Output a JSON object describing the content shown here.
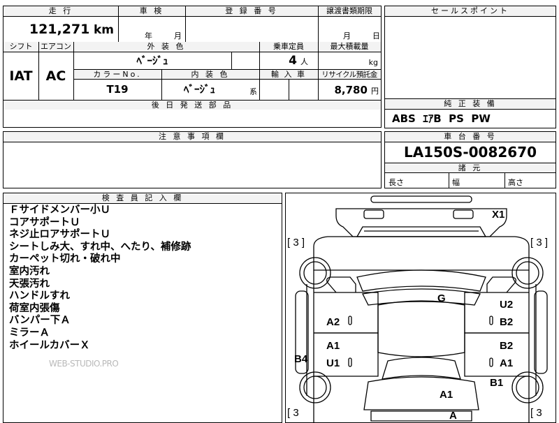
{
  "top": {
    "mileage_header": "走 行",
    "mileage_value": "121,271",
    "mileage_unit": "km",
    "inspection_header": "車 検",
    "inspection_year": "年",
    "inspection_month": "月",
    "registration_header": "登 録 番 号",
    "transfer_header": "譲渡書類期限",
    "transfer_month": "月",
    "transfer_day": "日",
    "shift_header": "シフト",
    "shift_value": "IAT",
    "ac_header": "エアコン",
    "ac_value": "AC",
    "exterior_color_header": "外 装 色",
    "exterior_color_value": "ﾍﾞｰｼﾞｭ",
    "capacity_header": "乗車定員",
    "capacity_value": "4",
    "capacity_unit": "人",
    "max_load_header": "最大積載量",
    "max_load_unit": "kg",
    "color_no_header": "カラーNo.",
    "color_no_value": "T19",
    "interior_color_header": "内 装 色",
    "interior_color_value": "ﾍﾞｰｼﾞｭ",
    "interior_color_suffix": "系",
    "import_header": "輸 入 車",
    "recycle_header": "リサイクル預託金",
    "recycle_value": "8,780",
    "recycle_unit": "円",
    "later_parts_header": "後 日 発 送 部 品"
  },
  "sales_point": {
    "header": "セールスポイント"
  },
  "equipment": {
    "header": "純 正 装 備",
    "value": "ABS  ｴｱB  PS  PW"
  },
  "notes": {
    "header": "注 意 事 項 欄"
  },
  "chassis": {
    "header": "車 台 番 号",
    "value": "LA150S-0082670",
    "dims_header": "諸 元",
    "length_label": "長さ",
    "width_label": "幅",
    "height_label": "高さ"
  },
  "inspector": {
    "header": "検 査 員 記 入 欄",
    "items": [
      "Ｆサイドメンバー小Ｕ",
      "コアサポートＵ",
      "ネジ止ロアサポートＵ",
      "シートしみ大、すれ中、へたり、補修跡",
      "カーペット切れ・破れ中",
      "室内汚れ",
      "天張汚れ",
      "ハンドルすれ",
      "荷室内張傷",
      "バンパー下Ａ",
      "ミラーＡ",
      "ホイールカバーＸ"
    ],
    "watermark": "WEB-STUDIO.PRO"
  },
  "diagram": {
    "x1": "X1",
    "bracket_tl": "[ 3 ]",
    "bracket_tr": "[ 3 ]",
    "bracket_bl": "[ 3",
    "bracket_br": "[ 3",
    "roof": "G",
    "left_front_door": "A2",
    "right_front_door_top": "U2",
    "right_front_door_bottom": "B2",
    "left_rear_door_top": "A1",
    "left_rear_door_bottom": "U1",
    "right_rear_door_top": "B2",
    "right_rear_door_bottom": "A1",
    "left_side": "B4",
    "right_rear_wheel": "B1",
    "rear_panel": "A1",
    "rear_bumper": "A"
  }
}
